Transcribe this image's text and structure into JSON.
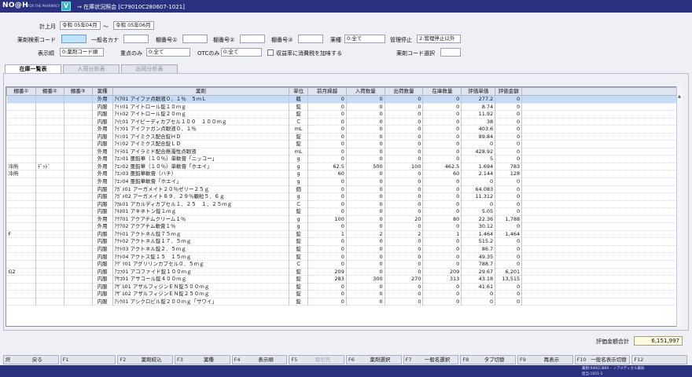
{
  "app": {
    "logo": "NO@H",
    "logo_sub": "FOR THE PHARMACY",
    "brand_mark": "V",
    "window_title": "→ 在庫状況照会 [C79010C280607-1021]"
  },
  "filters": {
    "period_label": "計上月",
    "period_from": "令和 05年04月",
    "period_sep": "～",
    "period_to": "令和 05年06月",
    "drug_code_label": "薬剤検索コード",
    "drug_code_value": "",
    "general_name_label": "一般名カナ",
    "general_name_value": "",
    "shelf1_label": "棚番号①",
    "shelf1_value": "",
    "shelf2_label": "棚番号②",
    "shelf2_value": "",
    "shelf3_label": "棚番号③",
    "shelf3_value": "",
    "category_label": "薬種",
    "category_value": "0:全て",
    "stop_label": "管理停止",
    "stop_value": "2:管理停止以外",
    "order_label": "表示順",
    "order_value": "0:薬剤コード順",
    "focus_label": "重点のみ",
    "focus_value": "0:全て",
    "otc_label": "OTCのみ",
    "otc_value": "0:全て",
    "tax_label": "収益率に消費税を加味する",
    "drug_select_label": "薬剤コード選択",
    "drug_select_value": ""
  },
  "tabs": [
    "在庫一覧表",
    "入荷分析表",
    "出荷分析表"
  ],
  "table": {
    "columns": [
      "棚番①",
      "棚番②",
      "棚番③",
      "薬種",
      "薬剤",
      "単位",
      "前月繰越",
      "入荷数量",
      "出荷数量",
      "在庫数量",
      "評価単価",
      "評価金額"
    ],
    "rows": [
      [
        "",
        "",
        "",
        "外用",
        "ｱｲｱ01 アイファ点眼液０．１％　５ｍＬ",
        "瓶",
        "0",
        "0",
        "0",
        "0",
        "277.2",
        "0"
      ],
      [
        "",
        "",
        "",
        "内服",
        "ｱｲﾄ01 アイトロール錠１０ｍｇ",
        "錠",
        "0",
        "0",
        "0",
        "0",
        "8.74",
        "0"
      ],
      [
        "",
        "",
        "",
        "内服",
        "ｱｲﾄ02 アイトロール錠２０ｍｇ",
        "錠",
        "0",
        "0",
        "0",
        "0",
        "11.92",
        "0"
      ],
      [
        "",
        "",
        "",
        "内服",
        "ｱｲﾋ01 アイピーディカプセル１００　１００ｍｇ",
        "Ｃ",
        "0",
        "0",
        "0",
        "0",
        "38",
        "0"
      ],
      [
        "",
        "",
        "",
        "外用",
        "ｱｲﾌ01 アイファガン点眼液０．１％",
        "mL",
        "0",
        "0",
        "0",
        "0",
        "403.6",
        "0"
      ],
      [
        "",
        "",
        "",
        "内服",
        "ｱｲﾐ01 アイミクス配合錠ＨＤ",
        "錠",
        "0",
        "0",
        "0",
        "0",
        "89.84",
        "0"
      ],
      [
        "",
        "",
        "",
        "内服",
        "ｱｲﾐ02 アイミクス配合錠ＬＤ",
        "錠",
        "0",
        "0",
        "0",
        "0",
        "0",
        "0"
      ],
      [
        "",
        "",
        "",
        "外用",
        "ｱｲﾗ01 アイラミド配合懸濁性点眼液",
        "mL",
        "0",
        "0",
        "0",
        "0",
        "428.92",
        "0"
      ],
      [
        "",
        "",
        "",
        "外用",
        "ｱｴﾝ01 亜鉛華（１０％）単軟膏「ニッコー」",
        "g",
        "0",
        "0",
        "0",
        "0",
        "5",
        "0"
      ],
      [
        "冷所",
        "ﾃﾞｯﾄﾞ",
        "",
        "外用",
        "ｱｴﾝ02 亜鉛華（１０％）単軟膏「ホエイ」",
        "g",
        "62.5",
        "500",
        "100",
        "462.5",
        "1.694",
        "783"
      ],
      [
        "冷所",
        "",
        "",
        "外用",
        "ｱｴﾝ03 亜鉛華軟膏（ハチ）",
        "g",
        "60",
        "0",
        "0",
        "60",
        "2.144",
        "128"
      ],
      [
        "",
        "",
        "",
        "外用",
        "ｱｴﾝ04 亜鉛華軟膏「ホエイ」",
        "g",
        "0",
        "0",
        "0",
        "0",
        "0",
        "0"
      ],
      [
        "",
        "",
        "",
        "内服",
        "ｱｶﾞﾒ01 アーガメイト２０％ゼリー２５ｇ",
        "個",
        "0",
        "0",
        "0",
        "0",
        "64.083",
        "0"
      ],
      [
        "",
        "",
        "",
        "内服",
        "ｱｶﾞﾒ02 アーガメイト８９．２９％顆粒５．６ｇ",
        "g",
        "0",
        "0",
        "0",
        "0",
        "11.312",
        "0"
      ],
      [
        "",
        "",
        "",
        "内服",
        "ｱｶﾙ01 アカルディカプセル１．２５　１．２５ｍｇ",
        "Ｃ",
        "0",
        "0",
        "0",
        "0",
        "0",
        "0"
      ],
      [
        "",
        "",
        "",
        "内服",
        "ｱｷﾈ01 アキネトン錠１ｍｇ",
        "錠",
        "0",
        "0",
        "0",
        "0",
        "5.05",
        "0"
      ],
      [
        "",
        "",
        "",
        "外用",
        "ｱｸｱ01 アクアチムクリーム１％",
        "g",
        "100",
        "0",
        "20",
        "80",
        "22.36",
        "1,788"
      ],
      [
        "",
        "",
        "",
        "外用",
        "ｱｸｱ02 アクアチム軟膏１％",
        "g",
        "0",
        "0",
        "0",
        "0",
        "30.12",
        "0"
      ],
      [
        "F",
        "",
        "",
        "内服",
        "ｱｸﾄ01 アクトネル錠７５ｍｇ",
        "錠",
        "1",
        "2",
        "2",
        "1",
        "1,464",
        "1,464"
      ],
      [
        "",
        "",
        "",
        "内服",
        "ｱｸﾄ02 アクトネル錠１７．５ｍｇ",
        "錠",
        "0",
        "0",
        "0",
        "0",
        "515.2",
        "0"
      ],
      [
        "",
        "",
        "",
        "内服",
        "ｱｸﾄ03 アクトネル錠２．５ｍｇ",
        "錠",
        "0",
        "0",
        "0",
        "0",
        "86.7",
        "0"
      ],
      [
        "",
        "",
        "",
        "内服",
        "ｱｸﾄ04 アクトス錠１５　１５ｍｇ",
        "錠",
        "0",
        "0",
        "0",
        "0",
        "49.35",
        "0"
      ],
      [
        "",
        "",
        "",
        "内服",
        "ｱｸﾞﾘ01 アグリリンカプセル０．５ｍｇ",
        "Ｃ",
        "0",
        "0",
        "0",
        "0",
        "788.7",
        "0"
      ],
      [
        "G2",
        "",
        "",
        "内服",
        "ｱｺﾌ01 アコファイド錠１００ｍｇ",
        "錠",
        "209",
        "0",
        "0",
        "209",
        "29.67",
        "6,201"
      ],
      [
        "",
        "",
        "",
        "内服",
        "ｱｻｺ01 アサコール錠４００ｍｇ",
        "錠",
        "283",
        "300",
        "270",
        "313",
        "43.18",
        "13,515"
      ],
      [
        "",
        "",
        "",
        "内服",
        "ｱｻﾞﾙ01 アザルフィジンＥＮ錠５００ｍｇ",
        "錠",
        "0",
        "0",
        "0",
        "0",
        "41.61",
        "0"
      ],
      [
        "",
        "",
        "",
        "内服",
        "ｱｻﾞﾙ02 アザルフィジンＥＮ錠２５０ｍｇ",
        "錠",
        "0",
        "0",
        "0",
        "0",
        "0",
        "0"
      ],
      [
        "",
        "",
        "",
        "内服",
        "ｱｼｸ01 アシクロビル錠２００ｍｇ「サワイ」",
        "錠",
        "0",
        "0",
        "0",
        "0",
        "0",
        "0"
      ]
    ]
  },
  "total": {
    "label": "評価金額合計",
    "value": "6,151,997"
  },
  "fkeys": [
    {
      "key": "終",
      "label": "戻る",
      "enabled": true
    },
    {
      "key": "F1",
      "label": "",
      "enabled": false
    },
    {
      "key": "F2",
      "label": "薬剤絞込",
      "enabled": true
    },
    {
      "key": "F3",
      "label": "薬種",
      "enabled": true
    },
    {
      "key": "F4",
      "label": "表示順",
      "enabled": true
    },
    {
      "key": "F5",
      "label": "取引先",
      "enabled": false
    },
    {
      "key": "F6",
      "label": "薬剤選択",
      "enabled": true
    },
    {
      "key": "F7",
      "label": "一般名選択",
      "enabled": true
    },
    {
      "key": "F8",
      "label": "タブ切替",
      "enabled": true
    },
    {
      "key": "F9",
      "label": "再表示",
      "enabled": true
    },
    {
      "key": "F10",
      "label": "一般名表示切替",
      "enabled": true
    },
    {
      "key": "F12",
      "label": "",
      "enabled": false
    }
  ],
  "status": {
    "line1": "薬剤:040(C)860 ｰ ノアメディカル薬局",
    "line2": "担当:1021-1"
  },
  "colors": {
    "titlebar": "#2a3280",
    "selected_row": "#c6dcf6",
    "input_highlight": "#bfe2ff"
  }
}
